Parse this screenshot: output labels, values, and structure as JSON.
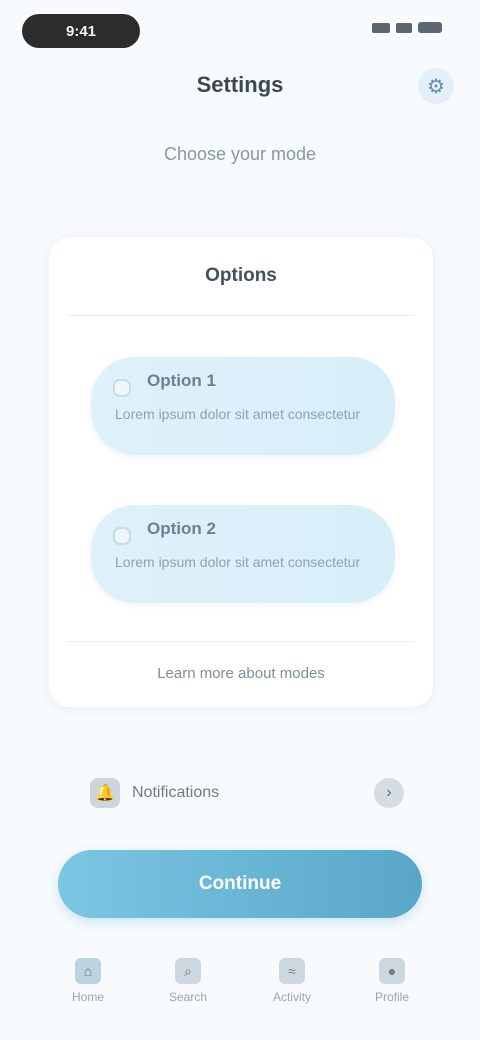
{
  "status": {
    "time": "9:41"
  },
  "header": {
    "title": "Settings",
    "action_icon": "gear-icon"
  },
  "subtitle": "Choose your mode",
  "card": {
    "title": "Options",
    "options": [
      {
        "label": "Option 1",
        "description": "Lorem ipsum dolor sit amet consectetur",
        "selected": false
      },
      {
        "label": "Option 2",
        "description": "Lorem ipsum dolor sit amet consectetur",
        "selected": false
      }
    ],
    "footer": "Learn more about modes"
  },
  "row": {
    "label": "Notifications",
    "icon": "bell-icon",
    "trailing_icon": "chevron-right-icon"
  },
  "cta": {
    "label": "Continue"
  },
  "tabs": [
    {
      "label": "Home",
      "icon": "home-icon"
    },
    {
      "label": "Search",
      "icon": "search-icon"
    },
    {
      "label": "Activity",
      "icon": "activity-icon"
    },
    {
      "label": "Profile",
      "icon": "profile-icon"
    }
  ],
  "colors": {
    "accent": "#5aa6c9",
    "option_bg": "#dff1fa",
    "background": "#f7fbfd"
  }
}
